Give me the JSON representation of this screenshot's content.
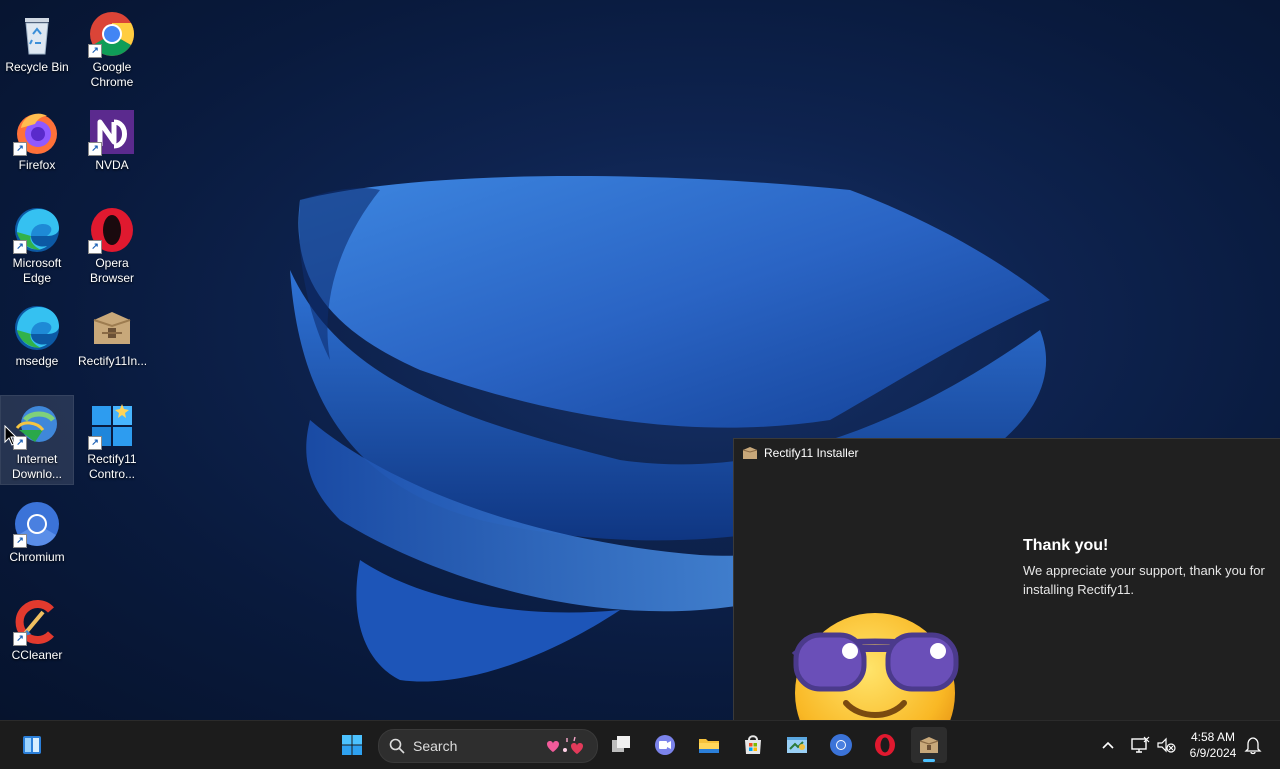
{
  "desktop": {
    "icons": [
      {
        "label": "Recycle Bin",
        "icon": "recycle-bin-icon"
      },
      {
        "label": "Google Chrome",
        "icon": "chrome-icon"
      },
      {
        "label": "Firefox",
        "icon": "firefox-icon"
      },
      {
        "label": "NVDA",
        "icon": "nvda-icon"
      },
      {
        "label": "Microsoft Edge",
        "icon": "edge-icon"
      },
      {
        "label": "Opera Browser",
        "icon": "opera-icon"
      },
      {
        "label": "msedge",
        "icon": "edge-icon"
      },
      {
        "label": "Rectify11In...",
        "icon": "package-icon"
      },
      {
        "label": "Internet Downlo...",
        "icon": "internet-download-manager-icon"
      },
      {
        "label": "Rectify11 Contro...",
        "icon": "windows-logo-icon"
      },
      {
        "label": "Chromium",
        "icon": "chromium-icon"
      },
      {
        "label": "CCleaner",
        "icon": "ccleaner-icon"
      }
    ]
  },
  "installer": {
    "title": "Rectify11 Installer",
    "heading": "Thank you!",
    "message": "We appreciate your support, thank you for installing Rectify11."
  },
  "taskbar": {
    "search_label": "Search",
    "time": "4:58 AM",
    "date": "6/9/2024",
    "pinned": [
      "widgets-icon",
      "start-icon",
      "task-view-icon",
      "teams-icon",
      "file-explorer-icon",
      "store-icon",
      "control-panel-icon",
      "chromium-icon",
      "opera-icon",
      "rectify11-installer-icon"
    ],
    "tray": [
      "show-hidden-icons-chevron",
      "network-icon",
      "volume-muted-icon",
      "notifications-icon"
    ]
  },
  "colors": {
    "accent": "#4cc2ff",
    "taskbar_bg": "#1c1c1c",
    "window_bg": "#202020"
  }
}
